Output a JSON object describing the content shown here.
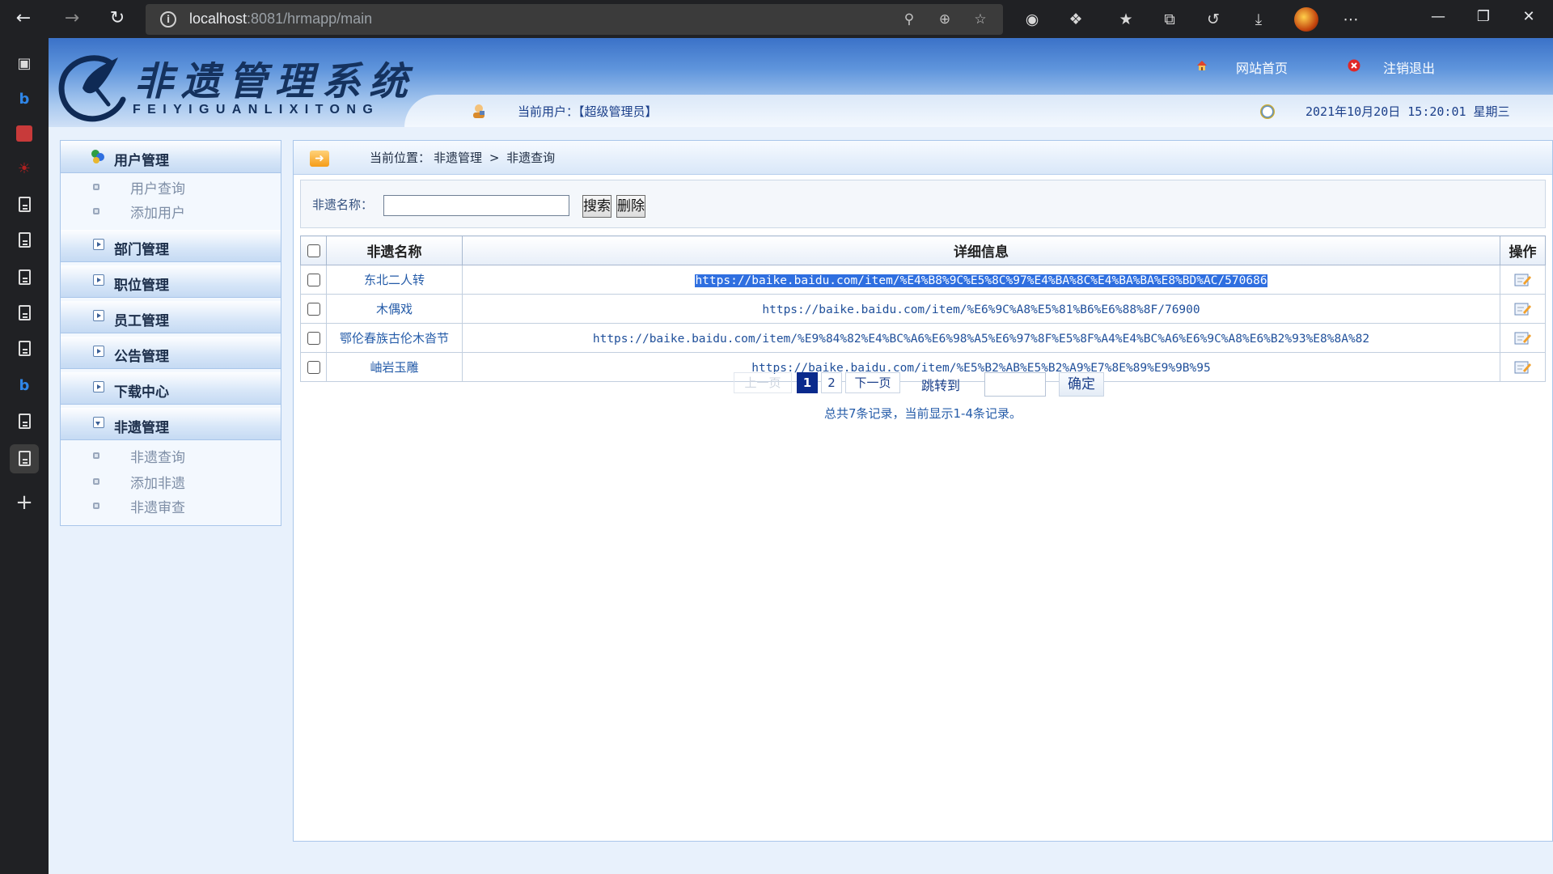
{
  "browser": {
    "url_host": "localhost",
    "url_rest": ":8081/hrmapp/main"
  },
  "header": {
    "logo_title": "非遗管理系统",
    "logo_subtitle": "FEIYIGUANLIXITONG",
    "home_link": "网站首页",
    "logout_link": "注销退出",
    "current_user": "当前用户：【超级管理员】",
    "datetime": "2021年10月20日 15:20:01 星期三"
  },
  "menu": {
    "groups": [
      {
        "label": "用户管理",
        "items": [
          "用户查询",
          "添加用户"
        ]
      },
      {
        "label": "部门管理"
      },
      {
        "label": "职位管理"
      },
      {
        "label": "员工管理"
      },
      {
        "label": "公告管理"
      },
      {
        "label": "下载中心"
      },
      {
        "label": "非遗管理",
        "items": [
          "非遗查询",
          "添加非遗",
          "非遗审查"
        ]
      }
    ]
  },
  "breadcrumb": {
    "prefix": "当前位置：",
    "section": "非遗管理",
    "separator": ">",
    "page": "非遗查询"
  },
  "search": {
    "label": "非遗名称：",
    "value": "",
    "search_button": "搜索",
    "delete_button": "删除"
  },
  "table": {
    "columns": [
      "非遗名称",
      "详细信息",
      "操作"
    ],
    "rows": [
      {
        "name": "东北二人转",
        "detail": "https://baike.baidu.com/item/%E4%B8%9C%E5%8C%97%E4%BA%8C%E4%BA%BA%E8%BD%AC/570686"
      },
      {
        "name": "木偶戏",
        "detail": "https://baike.baidu.com/item/%E6%9C%A8%E5%81%B6%E6%88%8F/76900"
      },
      {
        "name": "鄂伦春族古伦木沓节",
        "detail": "https://baike.baidu.com/item/%E9%84%82%E4%BC%A6%E6%98%A5%E6%97%8F%E5%8F%A4%E4%BC%A6%E6%9C%A8%E6%B2%93%E8%8A%82"
      },
      {
        "name": "岫岩玉雕",
        "detail": "https://baike.baidu.com/item/%E5%B2%AB%E5%B2%A9%E7%8E%89%E9%9B%95"
      }
    ]
  },
  "pager": {
    "prev": "上一页",
    "pages": [
      "1",
      "2"
    ],
    "next": "下一页",
    "jump_label": "跳转到",
    "confirm": "确定",
    "summary": "总共7条记录，当前显示1-4条记录。"
  },
  "colors": {
    "header_blue": "#3b72c8",
    "link_blue": "#245ba8",
    "current_page": "#0a2a8c",
    "selection": "#2f6fe0"
  }
}
